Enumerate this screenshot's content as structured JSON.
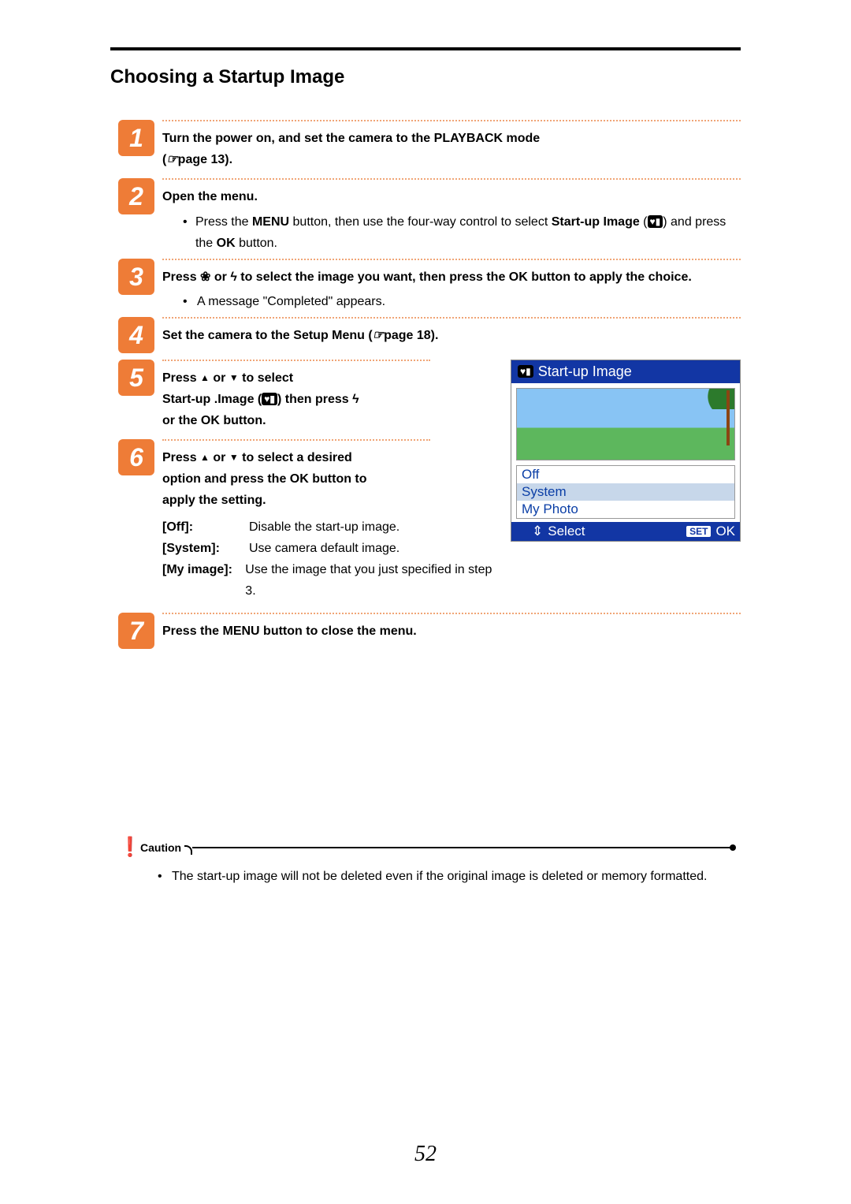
{
  "page": {
    "number": "52",
    "title": "Choosing a Startup Image"
  },
  "steps": {
    "s1": {
      "num": "1",
      "head_a": "Turn the power on, and set the camera to the PLAYBACK mode",
      "head_b_prefix": "(",
      "head_b_page": "page 13).",
      "icon": "☞"
    },
    "s2": {
      "num": "2",
      "head": "Open the menu.",
      "bullet_pre": "Press the ",
      "menu": "MENU",
      "bullet_mid": " button, then use the four-way control to select ",
      "startup": "Start-up Image",
      "bullet_post_a": " (",
      "icon_startup": "♥▮",
      "bullet_post_b": ") and press the ",
      "ok": "OK",
      "bullet_post_c": " button."
    },
    "s3": {
      "num": "3",
      "head_a": "Press ",
      "icon_macro": "❀",
      "head_b": " or ",
      "icon_flash": "ϟ",
      "head_c": " to select the image you want, then press the OK button to apply the choice.",
      "bullet": "A message \"Completed\" appears."
    },
    "s4": {
      "num": "4",
      "head_a": "Set the camera to the Setup Menu (",
      "icon": "☞",
      "head_b": "page 18)."
    },
    "s5": {
      "num": "5",
      "head_a": "Press ",
      "head_b": " or ",
      "head_c": " to select",
      "line2_a": "Start-up .Image (",
      "icon_startup": "♥▮",
      "line2_b": ") then press ",
      "icon_flash": "ϟ",
      "line3": "or the OK button."
    },
    "s6": {
      "num": "6",
      "head_a": "Press ",
      "head_b": " or ",
      "head_c": " to select a desired",
      "line2": "option and press the OK button to",
      "line3": "apply the setting.",
      "options": {
        "off": {
          "label": "[Off]:",
          "desc": "Disable the start-up image."
        },
        "system": {
          "label": "[System]:",
          "desc": "Use camera default image."
        },
        "my": {
          "label": "[My image]:",
          "desc": "Use the image that you just specified in step 3."
        }
      }
    },
    "s7": {
      "num": "7",
      "head": "Press the MENU button to close the menu."
    }
  },
  "screenshot": {
    "title": "Start-up Image",
    "icon": "♥▮",
    "options": {
      "off": "Off",
      "system": "System",
      "myphoto": "My Photo"
    },
    "footer": {
      "select": "Select",
      "updown": "⇕",
      "set": "SET",
      "ok": "OK"
    }
  },
  "caution": {
    "label": "Caution",
    "text": "The start-up image will not be deleted even if the original image is deleted or memory formatted."
  }
}
